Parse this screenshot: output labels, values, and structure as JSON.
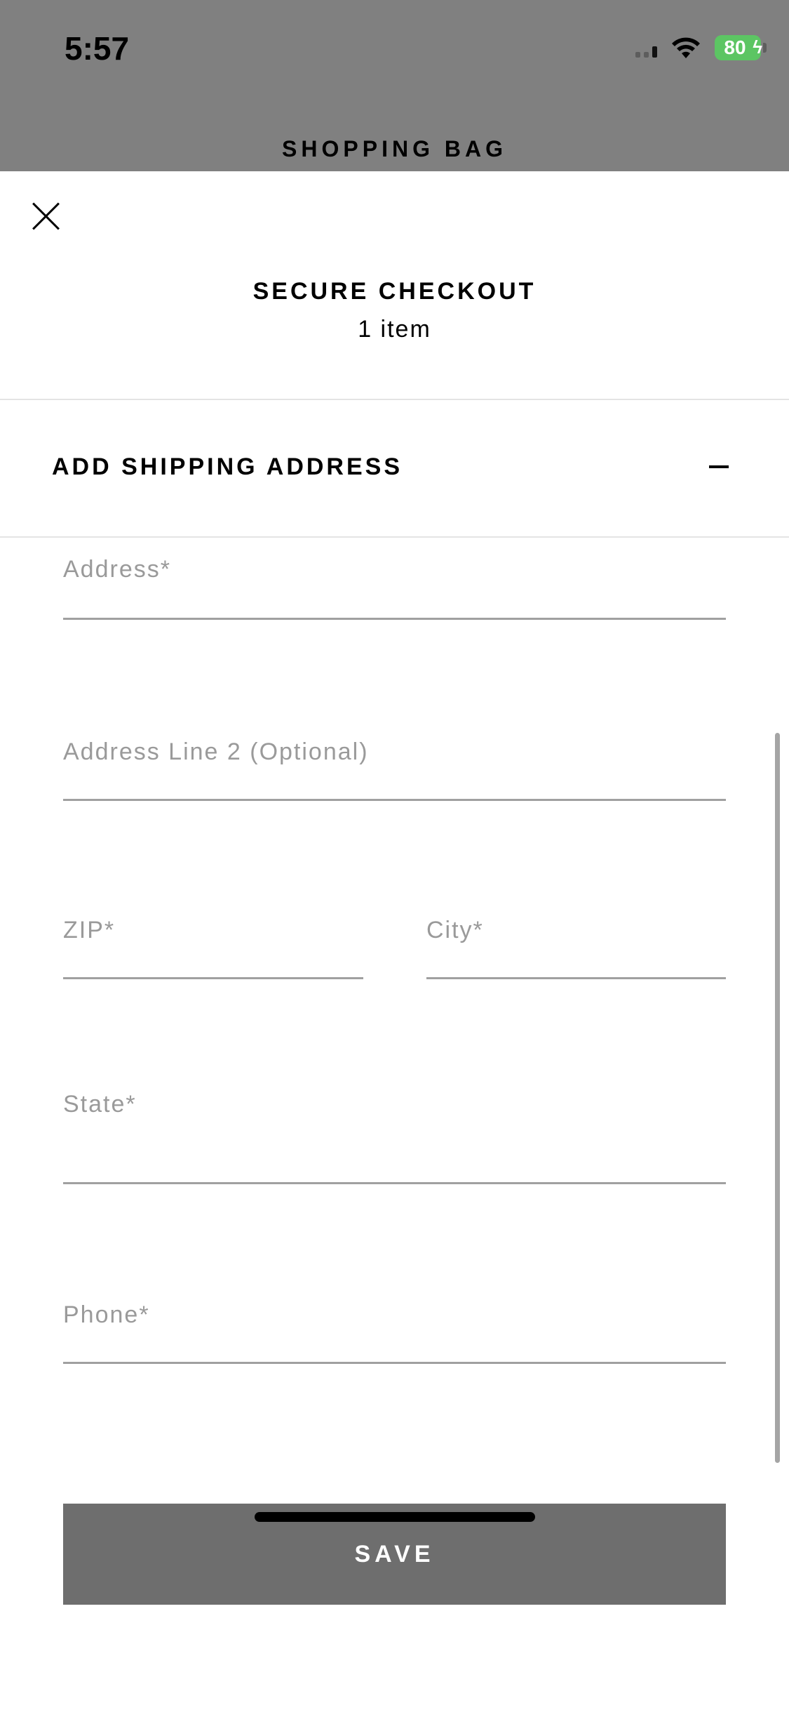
{
  "status_bar": {
    "time": "5:57",
    "battery": "80"
  },
  "background_title": "SHOPPING BAG",
  "sheet": {
    "title": "SECURE CHECKOUT",
    "subtitle": "1 item",
    "section_title": "ADD SHIPPING ADDRESS"
  },
  "form": {
    "address": "Address*",
    "address_line2": "Address Line 2 (Optional)",
    "zip": "ZIP*",
    "city": "City*",
    "state": "State*",
    "phone": "Phone*",
    "save_label": "SAVE"
  },
  "colors": {
    "button": "#6e6e6e",
    "backdrop": "#808080",
    "battery": "#5cc563"
  },
  "icons": {
    "close": "close-icon",
    "collapse": "minus-icon",
    "wifi": "wifi-icon"
  }
}
